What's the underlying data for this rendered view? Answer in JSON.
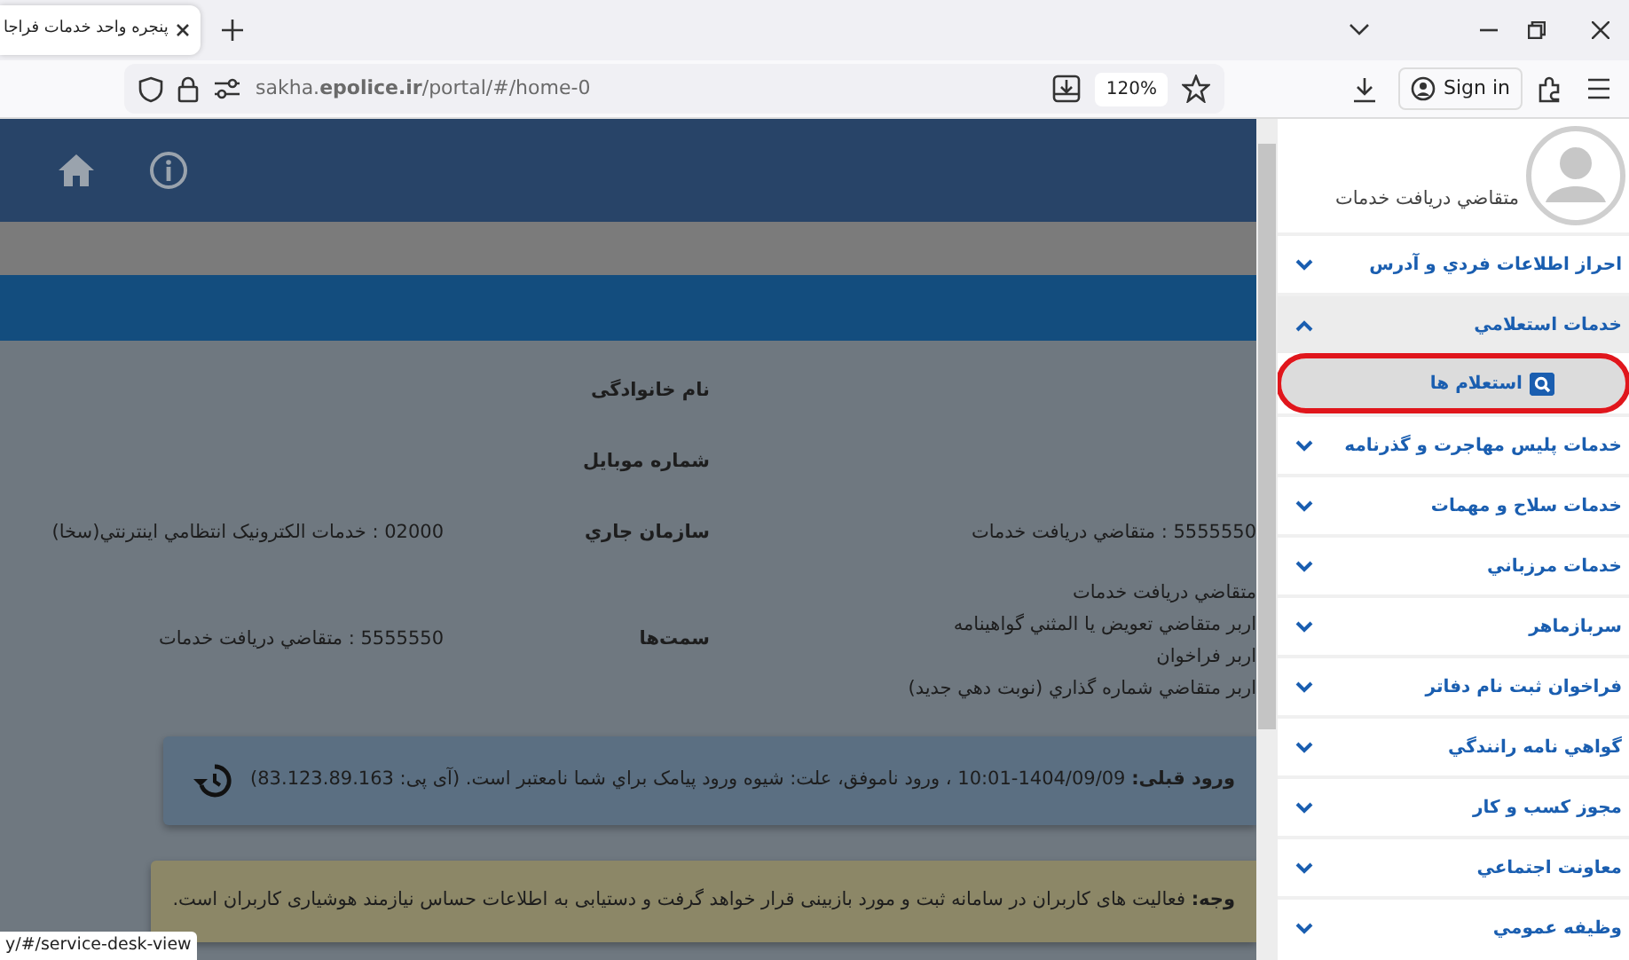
{
  "browser": {
    "tab": {
      "title": "پنجره واحد خدمات فراجا"
    },
    "url": "sakha.**epolice.ir**/portal/#/home-0",
    "zoom": "120%",
    "sign_in": "Sign in"
  },
  "profile": {
    "rows": [
      {
        "label": "نام خانوادگی"
      },
      {
        "label": "شماره موبایل"
      },
      {
        "right_value": "5555550 : متقاضي دريافت خدمات",
        "label": "سازمان جاري",
        "value": "02000 : خدمات الكترونيک انتظامي اينترنتي(سخا)"
      },
      {
        "right_values": [
          "متقاضي دريافت خدمات",
          "اربر متقاضي تعويض يا المثني گواهينامه",
          "اربر فراخوان",
          "اربر متقاضي شماره گذاري (نوبت دهي جديد)"
        ],
        "label": "سمت‌ها",
        "value": "5555550 : متقاضي دريافت خدمات"
      }
    ]
  },
  "alerts": [
    {
      "kind": "info",
      "text": "**ورود قبلی:** 1404/09/09-10:01 ، ورود ناموفق، علت: شيوه ورود پيامک براي شما نامعتبر است. (آی پی: 83.123.89.163)"
    },
    {
      "kind": "warning",
      "text": "**وجه:** فعالیت های کاربران در سامانه ثبت و مورد بازبینی قرار خواهد گرفت و دستیابی به اطلاعات حساس نیازمند هوشیاری کاربران است."
    }
  ],
  "status_url": "y/#/service-desk-view",
  "sidebar": {
    "user_name": "متقاضي دريافت خدمات",
    "menu": [
      {
        "label": "احراز اطلاعات فردي و آدرس",
        "expanded": false
      },
      {
        "label": "خدمات استعلامي",
        "expanded": true,
        "children": [
          {
            "label": "استعلام ها",
            "circled": true
          }
        ]
      },
      {
        "label": "خدمات پليس مهاجرت و گذرنامه",
        "expanded": false
      },
      {
        "label": "خدمات سلاح و مهمات",
        "expanded": false
      },
      {
        "label": "خدمات مرزباني",
        "expanded": false
      },
      {
        "label": "سربازماهر",
        "expanded": false
      },
      {
        "label": "فراخوان ثبت نام دفاتر",
        "expanded": false
      },
      {
        "label": "گواهي نامه رانندگي",
        "expanded": false
      },
      {
        "label": "مجوز کسب و کار",
        "expanded": false
      },
      {
        "label": "معاونت اجتماعي",
        "expanded": false
      },
      {
        "label": "وظيفه عمومي",
        "expanded": false
      }
    ]
  }
}
